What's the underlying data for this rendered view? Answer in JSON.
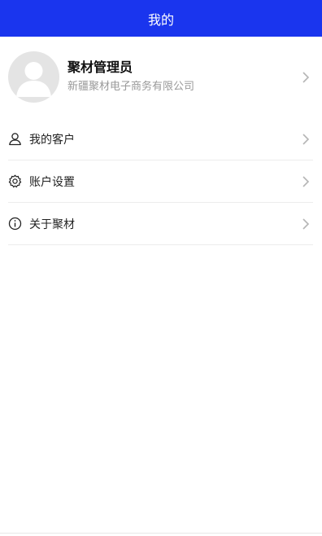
{
  "header": {
    "title": "我的"
  },
  "profile": {
    "name": "聚材管理员",
    "company": "新疆聚材电子商务有限公司"
  },
  "menu": {
    "items": [
      {
        "label": "我的客户",
        "icon": "user-icon"
      },
      {
        "label": "账户设置",
        "icon": "gear-icon"
      },
      {
        "label": "关于聚材",
        "icon": "info-icon"
      }
    ]
  },
  "colors": {
    "header_bg": "#1a35ee",
    "avatar_bg": "#e4e4e4",
    "subtle_text": "#999999"
  }
}
